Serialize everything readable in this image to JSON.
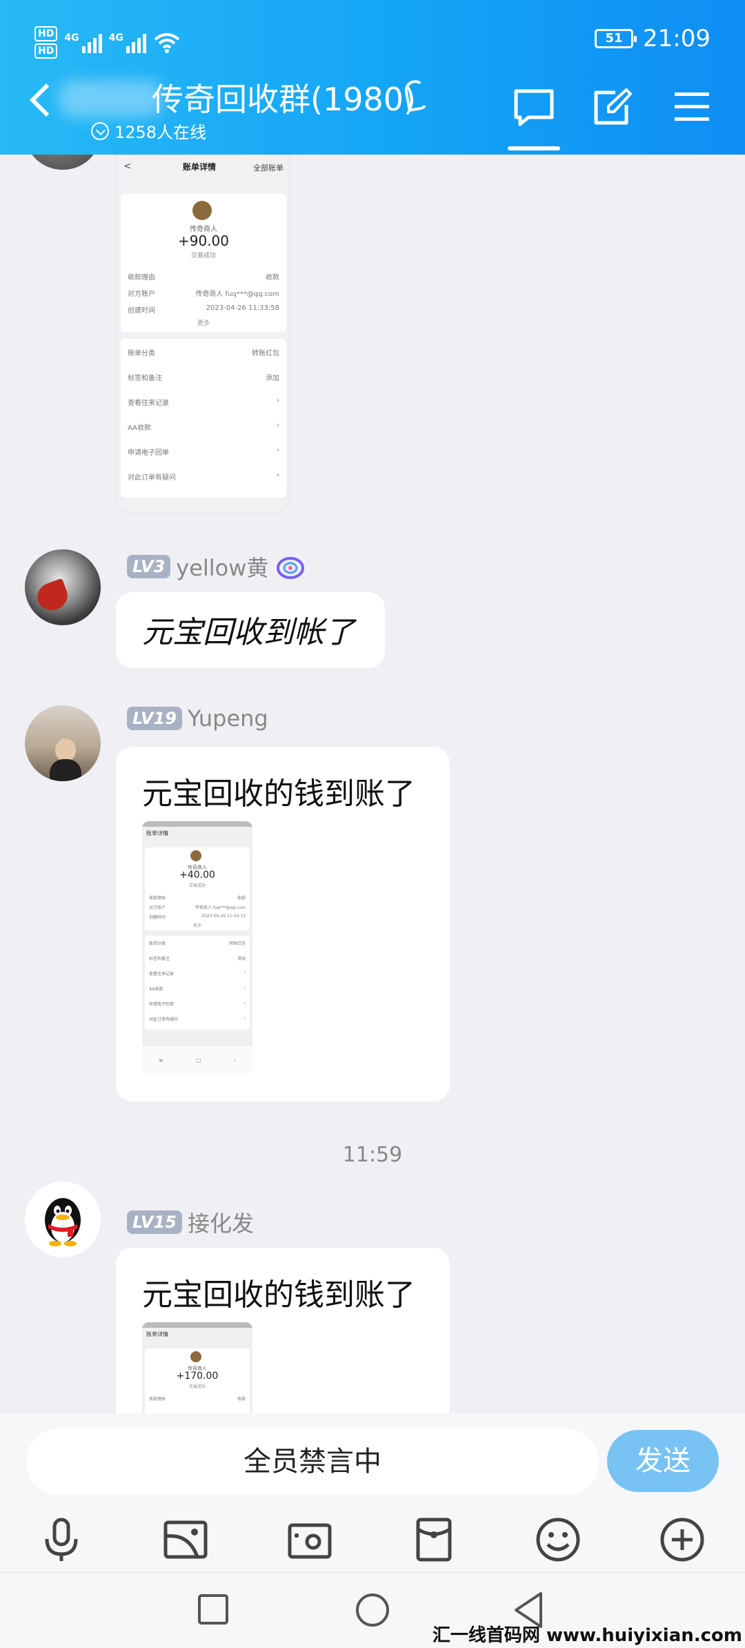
{
  "status_bar": {
    "hd1": "HD",
    "hd2": "HD",
    "net1": "4G",
    "net2": "4G",
    "battery": "51",
    "time": "21:09"
  },
  "header": {
    "title": "传奇回收群(1980)",
    "online": "1258人在线"
  },
  "messages": [
    {
      "type": "image",
      "shot": {
        "title": "账单详情",
        "right": "全部账单",
        "merchant": "传奇商人",
        "amount": "+90.00",
        "status": "交易成功",
        "rows": [
          {
            "k": "收款理由",
            "v": "收款"
          },
          {
            "k": "对方账户",
            "v": "传奇商人 fuq***@qq.com"
          },
          {
            "k": "创建时间",
            "v": "2023-04-26 11:33:58"
          }
        ],
        "more": "更多",
        "menu": [
          {
            "k": "账单分类",
            "v": "转账红包"
          },
          {
            "k": "标签和备注",
            "v": "添加"
          },
          {
            "k": "查看往来记录",
            "v": ""
          },
          {
            "k": "AA收款",
            "v": ""
          },
          {
            "k": "申请电子回单",
            "v": ""
          },
          {
            "k": "对此订单有疑问",
            "v": ""
          }
        ]
      }
    },
    {
      "level": "LV3",
      "name": "yellow黄",
      "text": "元宝回收到帐了"
    },
    {
      "level": "LV19",
      "name": "Yupeng",
      "text": "元宝回收的钱到账了",
      "shot": {
        "title": "账单详情",
        "merchant": "传奇商人",
        "amount": "+40.00",
        "status": "交易成功",
        "rows": [
          {
            "k": "收款理由",
            "v": "收款"
          },
          {
            "k": "对方账户",
            "v": "传奇商人 fuq***@qq.com"
          },
          {
            "k": "创建时间",
            "v": "2023-04-26 11:54:13"
          }
        ],
        "more": "更多",
        "menu": [
          {
            "k": "账单分类",
            "v": "转账红包"
          },
          {
            "k": "标签和备注",
            "v": "添加"
          },
          {
            "k": "查看往来记录",
            "v": ""
          },
          {
            "k": "AA收款",
            "v": ""
          },
          {
            "k": "申请电子回单",
            "v": ""
          },
          {
            "k": "对此订单有疑问",
            "v": ""
          }
        ]
      }
    },
    {
      "time": "11:59"
    },
    {
      "level": "LV15",
      "name": "接化发",
      "text": "元宝回收的钱到账了",
      "shot": {
        "title": "账单详情",
        "merchant": "传奇商人",
        "amount": "+170.00",
        "status": "交易成功",
        "rows": [
          {
            "k": "收款理由",
            "v": "收款"
          }
        ]
      }
    }
  ],
  "input": {
    "placeholder": "全员禁言中",
    "send_label": "发送"
  },
  "watermark": "汇一线首码网 www.huiyixian.com",
  "colors": {
    "header": "#14a4f6",
    "send": "#78c3f3",
    "level_badge": "#a9b2c5",
    "background": "#efeff4"
  }
}
